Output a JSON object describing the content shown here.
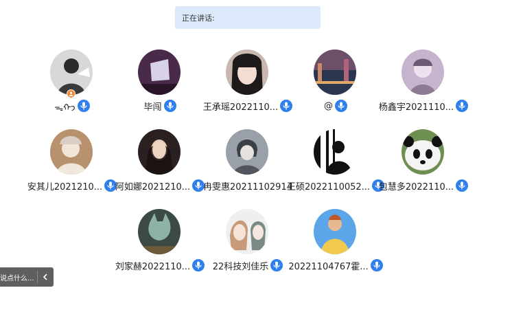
{
  "speaking": {
    "label": "正在讲话:"
  },
  "participants": [
    {
      "name": "ᯓᡣ𐭩",
      "mic_icon": "mic-icon",
      "host": true,
      "bg": "#d8d8d8",
      "fg": "#2b2b2b"
    },
    {
      "name": "毕闯",
      "mic_icon": "mic-icon",
      "bg": "#4a2a4a",
      "fg": "#d9d2e6"
    },
    {
      "name": "王承瑶2022110...",
      "mic_icon": "mic-icon",
      "bg": "#c9b8b0",
      "fg": "#1e1a1a"
    },
    {
      "name": "@",
      "mic_icon": "mic-icon",
      "bg": "#6d4f6a",
      "fg": "#2c3550"
    },
    {
      "name": "杨鑫宇2021110...",
      "mic_icon": "mic-icon",
      "bg": "#c6b4cc",
      "fg": "#6a5a72"
    },
    {
      "name": "安其儿2021210...",
      "mic_icon": "mic-icon",
      "bg": "#b8926f",
      "fg": "#f2e6d8"
    },
    {
      "name": "阿如娜2021210...",
      "mic_icon": "mic-icon",
      "bg": "#2a2020",
      "fg": "#e8cbb6"
    },
    {
      "name": "冉雯惠20211102914",
      "mic_icon": "mic-icon",
      "bg": "#9aa0a8",
      "fg": "#3b3f46"
    },
    {
      "name": "王硕2022110052...",
      "mic_icon": "mic-icon",
      "bg": "#ffffff",
      "fg": "#111111"
    },
    {
      "name": "包慧多2022110...",
      "mic_icon": "mic-icon",
      "bg": "#6f8f52",
      "fg": "#f4f4f4"
    },
    {
      "name": "刘家赫2022110...",
      "mic_icon": "mic-icon",
      "bg": "#3c4a44",
      "fg": "#8fb2a6"
    },
    {
      "name": "22科技刘佳乐",
      "mic_icon": "mic-icon",
      "bg": "#eef0ef",
      "fg": "#7c8a86"
    },
    {
      "name": "20221104767霍...",
      "mic_icon": "mic-icon",
      "bg": "#5ba6e8",
      "fg": "#f2c94c"
    }
  ],
  "comment": {
    "placeholder": "说点什么...",
    "collapse_icon": "chevron-left-icon"
  },
  "colors": {
    "mic": "#2f80ed",
    "speaking_bg": "#dbe9fb",
    "host_badge": "#f08a3c"
  }
}
